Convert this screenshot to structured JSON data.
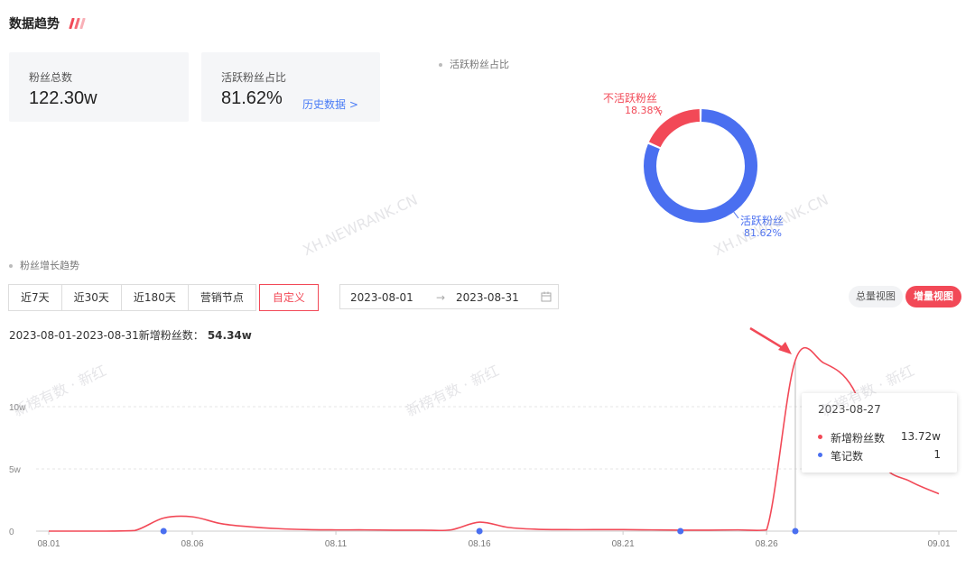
{
  "header": {
    "title": "数据趋势"
  },
  "cards": {
    "total": {
      "label": "粉丝总数",
      "value": "122.30w"
    },
    "active": {
      "label": "活跃粉丝占比",
      "value": "81.62%",
      "link": "历史数据 >"
    }
  },
  "donut": {
    "title": "活跃粉丝占比",
    "inactive_label": "不活跃粉丝",
    "inactive_value": "18.38%",
    "active_label": "活跃粉丝",
    "active_value": "81.62%",
    "inactive_color": "#f24957",
    "active_color": "#4a6ff0"
  },
  "growth": {
    "title": "粉丝增长趋势",
    "tabs": [
      "近7天",
      "近30天",
      "近180天",
      "营销节点",
      "自定义"
    ],
    "active_tab": "自定义",
    "date_start": "2023-08-01",
    "date_arrow": "→",
    "date_end": "2023-08-31",
    "calendar_icon": "calendar-icon",
    "view_total": "总量视图",
    "view_increment": "增量视图",
    "summary_label": "2023-08-01-2023-08-31新增粉丝数：",
    "summary_value": "54.34w"
  },
  "tooltip": {
    "date": "2023-08-27",
    "rows": [
      {
        "name": "新增粉丝数",
        "value": "13.72w",
        "color": "#f24957"
      },
      {
        "name": "笔记数",
        "value": "1",
        "color": "#4a6ff0"
      }
    ]
  },
  "watermarks": [
    "XH.NEWRANK.CN",
    "XH.NEWRANK.CN",
    "新榜有数 · 新红",
    "新榜有数 · 新红",
    "新榜有数 · 新红"
  ],
  "chart_data": {
    "type": "line",
    "title": "",
    "xlabel": "",
    "ylabel": "",
    "ylim": [
      0,
      15
    ],
    "y_unit": "w",
    "ytick_labels": [
      "0",
      "5w",
      "10w"
    ],
    "yticks": [
      0,
      5,
      10
    ],
    "xtick_labels": [
      "08.01",
      "08.06",
      "08.11",
      "08.16",
      "08.21",
      "08.26",
      "09.01"
    ],
    "x": [
      "08.01",
      "08.02",
      "08.03",
      "08.04",
      "08.05",
      "08.06",
      "08.07",
      "08.08",
      "08.09",
      "08.10",
      "08.11",
      "08.12",
      "08.13",
      "08.14",
      "08.15",
      "08.16",
      "08.17",
      "08.18",
      "08.19",
      "08.20",
      "08.21",
      "08.22",
      "08.23",
      "08.24",
      "08.25",
      "08.26",
      "08.27",
      "08.28",
      "08.29",
      "08.30",
      "08.31",
      "09.01"
    ],
    "series": [
      {
        "name": "新增粉丝数",
        "color": "#f24957",
        "values": [
          0,
          0,
          0,
          0.05,
          1.05,
          1.15,
          0.6,
          0.35,
          0.2,
          0.12,
          0.1,
          0.1,
          0.08,
          0.08,
          0.1,
          0.72,
          0.3,
          0.15,
          0.12,
          0.12,
          0.12,
          0.1,
          0.08,
          0.08,
          0.1,
          0.1,
          13.72,
          13.5,
          11.5,
          5.5,
          4.0,
          3.0
        ]
      }
    ],
    "notes_series": {
      "name": "笔记数",
      "color": "#4a6ff0",
      "points": [
        {
          "x": "08.05",
          "value": 1
        },
        {
          "x": "08.16",
          "value": 1
        },
        {
          "x": "08.23",
          "value": 1
        },
        {
          "x": "08.27",
          "value": 1
        }
      ]
    },
    "highlight_x": "08.27",
    "grid": true
  }
}
